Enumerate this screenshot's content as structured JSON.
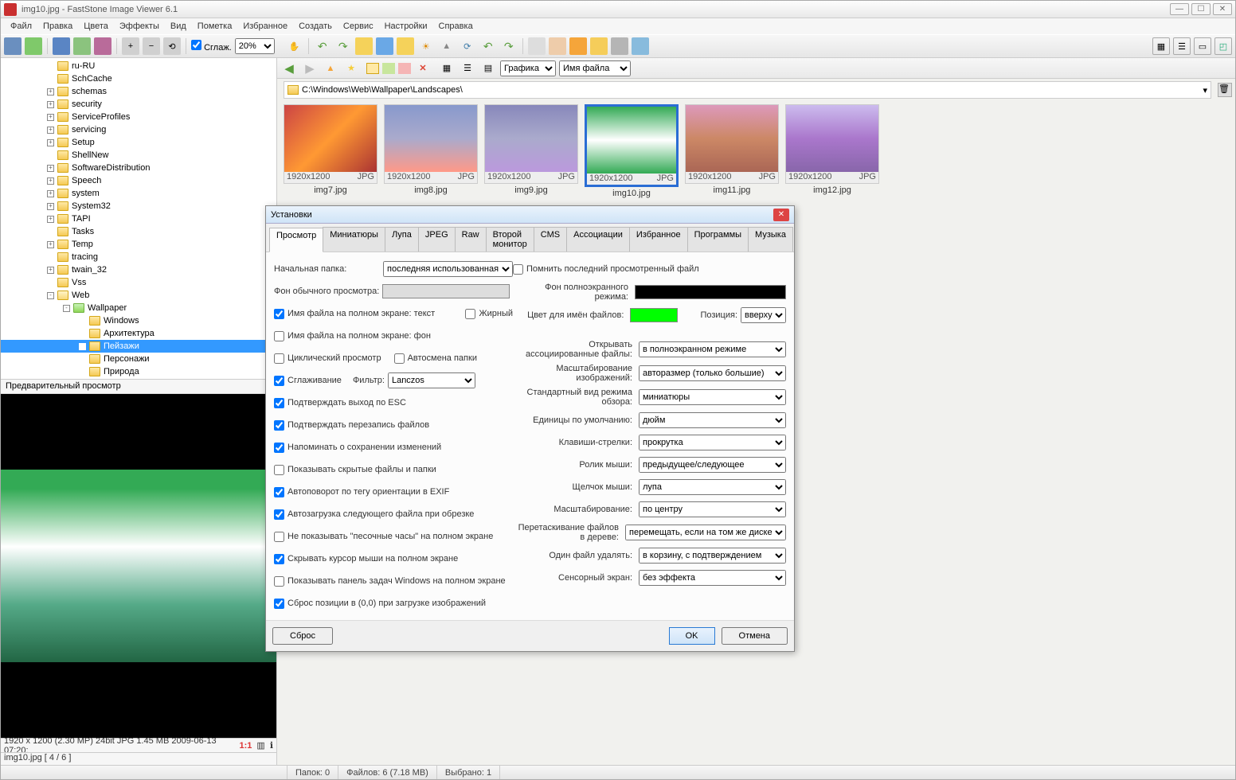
{
  "titlebar": {
    "title": "img10.jpg  -  FastStone Image Viewer 6.1"
  },
  "menubar": [
    "Файл",
    "Правка",
    "Цвета",
    "Эффекты",
    "Вид",
    "Пометка",
    "Избранное",
    "Создать",
    "Сервис",
    "Настройки",
    "Справка"
  ],
  "toolbar": {
    "smooth_label": "Сглаж.",
    "zoom": "20%"
  },
  "nav": {
    "view_select": "Графика",
    "sort_select": "Имя файла"
  },
  "path": "C:\\Windows\\Web\\Wallpaper\\Landscapes\\",
  "tree": [
    {
      "indent": 58,
      "exp": "",
      "label": "ru-RU"
    },
    {
      "indent": 58,
      "exp": "",
      "label": "SchCache"
    },
    {
      "indent": 58,
      "exp": "+",
      "label": "schemas"
    },
    {
      "indent": 58,
      "exp": "+",
      "label": "security"
    },
    {
      "indent": 58,
      "exp": "+",
      "label": "ServiceProfiles"
    },
    {
      "indent": 58,
      "exp": "+",
      "label": "servicing"
    },
    {
      "indent": 58,
      "exp": "+",
      "label": "Setup"
    },
    {
      "indent": 58,
      "exp": "",
      "label": "ShellNew"
    },
    {
      "indent": 58,
      "exp": "+",
      "label": "SoftwareDistribution"
    },
    {
      "indent": 58,
      "exp": "+",
      "label": "Speech"
    },
    {
      "indent": 58,
      "exp": "+",
      "label": "system"
    },
    {
      "indent": 58,
      "exp": "+",
      "label": "System32"
    },
    {
      "indent": 58,
      "exp": "+",
      "label": "TAPI"
    },
    {
      "indent": 58,
      "exp": "",
      "label": "Tasks"
    },
    {
      "indent": 58,
      "exp": "+",
      "label": "Temp"
    },
    {
      "indent": 58,
      "exp": "",
      "label": "tracing"
    },
    {
      "indent": 58,
      "exp": "+",
      "label": "twain_32"
    },
    {
      "indent": 58,
      "exp": "",
      "label": "Vss"
    },
    {
      "indent": 58,
      "exp": "-",
      "label": "Web",
      "open": true
    },
    {
      "indent": 78,
      "exp": "-",
      "label": "Wallpaper",
      "open": true,
      "green": true
    },
    {
      "indent": 98,
      "exp": "",
      "label": "Windows"
    },
    {
      "indent": 98,
      "exp": "",
      "label": "Архитектура"
    },
    {
      "indent": 98,
      "exp": "",
      "label": "Пейзажи",
      "selected": true
    },
    {
      "indent": 98,
      "exp": "",
      "label": "Персонажи"
    },
    {
      "indent": 98,
      "exp": "",
      "label": "Природа"
    }
  ],
  "preview_header": "Предварительный просмотр",
  "preview_info": "1920 x 1200 (2.30 MP)  24bit  JPG   1.45 MB   2009-06-13 07:20:",
  "preview_idx": "img10.jpg [ 4 / 6 ]",
  "thumbs": [
    {
      "name": "img7.jpg",
      "dim": "1920x1200",
      "fmt": "JPG",
      "bg": "linear-gradient(135deg,#c44,#f93,#a33)"
    },
    {
      "name": "img8.jpg",
      "dim": "1920x1200",
      "fmt": "JPG",
      "bg": "linear-gradient(#89c,#aac,#f98)"
    },
    {
      "name": "img9.jpg",
      "dim": "1920x1200",
      "fmt": "JPG",
      "bg": "linear-gradient(#88b,#aac,#b9d)"
    },
    {
      "name": "img10.jpg",
      "dim": "1920x1200",
      "fmt": "JPG",
      "bg": "linear-gradient(#3a5,#fff 50%,#3a5)",
      "selected": true
    },
    {
      "name": "img11.jpg",
      "dim": "1920x1200",
      "fmt": "JPG",
      "bg": "linear-gradient(#d9b,#c86,#a65)"
    },
    {
      "name": "img12.jpg",
      "dim": "1920x1200",
      "fmt": "JPG",
      "bg": "linear-gradient(#cbe,#a7c,#86a)"
    }
  ],
  "dialog": {
    "title": "Установки",
    "tabs": [
      "Просмотр",
      "Миниатюры",
      "Лупа",
      "JPEG",
      "Raw",
      "Второй монитор",
      "CMS",
      "Ассоциации",
      "Избранное",
      "Программы",
      "Музыка"
    ],
    "active_tab": 0,
    "left": {
      "start_folder_label": "Начальная папка:",
      "start_folder_value": "последняя использованная",
      "bg_view_label": "Фон обычного просмотра:",
      "cb_name_fs_text": "Имя файла на полном экране: текст",
      "cb_bold": "Жирный",
      "cb_name_fs_bg": "Имя файла на полном экране: фон",
      "cb_cycle": "Циклический просмотр",
      "cb_autofolder": "Автосмена папки",
      "cb_smooth": "Сглаживание",
      "filter_label": "Фильтр:",
      "filter_value": "Lanczos",
      "cb_confirm_esc": "Подтверждать выход по ESC",
      "cb_confirm_overwrite": "Подтверждать перезапись файлов",
      "cb_remind_save": "Напоминать о сохранении изменений",
      "cb_show_hidden": "Показывать скрытые файлы и папки",
      "cb_exif_rotate": "Автоповорот по тегу ориентации в EXIF",
      "cb_autoload_crop": "Автозагрузка следующего файла при обрезке",
      "cb_no_hourglass": "Не показывать \"песочные часы\" на полном экране",
      "cb_hide_cursor": "Скрывать курсор мыши на полном экране",
      "cb_taskbar_fs": "Показывать панель задач Windows на полном экране",
      "cb_reset_pos": "Сброс позиции в (0,0) при загрузке изображений"
    },
    "right": {
      "cb_remember_last": "Помнить последний просмотренный файл",
      "bg_fs_label": "Фон полноэкранного режима:",
      "name_color_label": "Цвет для имён файлов:",
      "pos_label": "Позиция:",
      "pos_value": "вверху",
      "open_assoc_label": "Открывать ассоциированные файлы:",
      "open_assoc_value": "в полноэкранном режиме",
      "scale_label": "Масштабирование изображений:",
      "scale_value": "авторазмер (только большие)",
      "default_view_label": "Стандартный вид режима обзора:",
      "default_view_value": "миниатюры",
      "units_label": "Единицы по умолчанию:",
      "units_value": "дюйм",
      "arrows_label": "Клавиши-стрелки:",
      "arrows_value": "прокрутка",
      "wheel_label": "Ролик мыши:",
      "wheel_value": "предыдущее/следующее",
      "click_label": "Щелчок мыши:",
      "click_value": "лупа",
      "zoom_label": "Масштабирование:",
      "zoom_value": "по центру",
      "drag_label": "Перетаскивание файлов в дереве:",
      "drag_value": "перемещать, если на том же диске",
      "delete_label": "Один файл удалять:",
      "delete_value": "в корзину, с подтверждением",
      "touch_label": "Сенсорный экран:",
      "touch_value": "без эффекта"
    },
    "buttons": {
      "reset": "Сброс",
      "ok": "OK",
      "cancel": "Отмена"
    }
  },
  "statusbar": {
    "folders": "Папок: 0",
    "files": "Файлов: 6 (7.18 MB)",
    "selected": "Выбрано: 1"
  }
}
